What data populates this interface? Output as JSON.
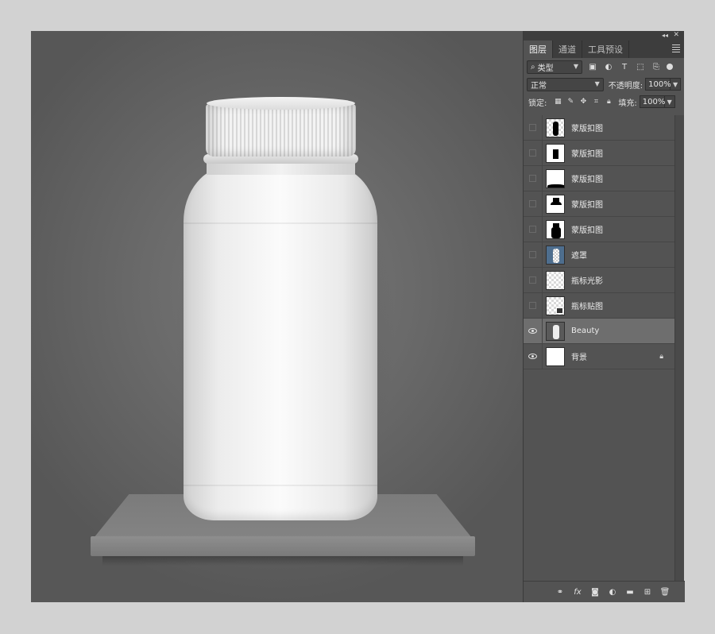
{
  "panel": {
    "tabs": [
      "图层",
      "通道",
      "工具预设"
    ],
    "filter_kind": "类型",
    "blend_mode": "正常",
    "opacity_label": "不透明度:",
    "opacity_value": "100%",
    "lock_label": "锁定:",
    "fill_label": "填充:",
    "fill_value": "100%"
  },
  "layers": [
    {
      "name": "蒙版扣图",
      "visible": false,
      "thumb": "mask-cap"
    },
    {
      "name": "蒙版扣图",
      "visible": false,
      "thumb": "mask-rect"
    },
    {
      "name": "蒙版扣图",
      "visible": false,
      "thumb": "mask-bottom"
    },
    {
      "name": "蒙版扣图",
      "visible": false,
      "thumb": "mask-top"
    },
    {
      "name": "蒙版扣图",
      "visible": false,
      "thumb": "mask-bottle"
    },
    {
      "name": "遮罩",
      "visible": false,
      "thumb": "mask-blue"
    },
    {
      "name": "瓶标光影",
      "visible": false,
      "thumb": "transparent"
    },
    {
      "name": "瓶标贴图",
      "visible": false,
      "thumb": "smart-object"
    },
    {
      "name": "Beauty",
      "visible": true,
      "thumb": "bottle",
      "selected": true
    },
    {
      "name": "背景",
      "visible": true,
      "thumb": "white",
      "locked": true
    }
  ],
  "icons": {
    "collapse": "double-chevron-left-icon",
    "close": "close-icon",
    "menu": "panel-menu-icon"
  }
}
